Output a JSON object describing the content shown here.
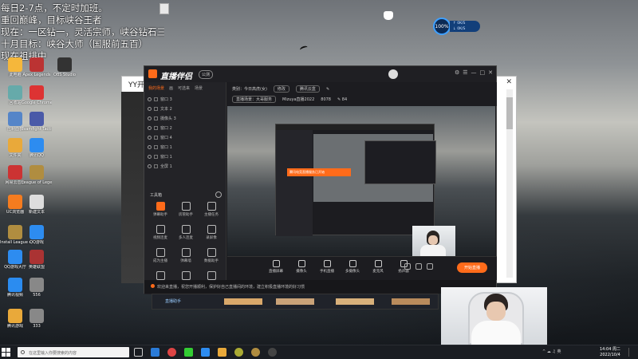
{
  "overlay": {
    "lines": [
      "每日2-7点，不定时加班。",
      "重回巅峰，目标峡谷王者",
      "现在：一区钻一，灵活宗师，峡谷钻石三",
      "十月目标：峡谷大师（国服前五百）",
      "现在祖排中"
    ]
  },
  "desktop_icons": [
    {
      "label": "此电脑",
      "color": "#f5b73b"
    },
    {
      "label": "Apex Legends",
      "color": "#b33"
    },
    {
      "label": "OBS Studio",
      "color": "#333"
    },
    {
      "label": "回收站",
      "color": "#6aa"
    },
    {
      "label": "Google Chrome",
      "color": "#d33"
    },
    {
      "label": "控制面板",
      "color": "#5585c8"
    },
    {
      "label": "Teamfight Tactics",
      "color": "#4a5aa8"
    },
    {
      "label": "文件夹",
      "color": "#e9a93a"
    },
    {
      "label": "腾讯QQ",
      "color": "#2d8cf0"
    },
    {
      "label": "网易云音乐",
      "color": "#c33"
    },
    {
      "label": "League of Legends",
      "color": "#b08d40"
    },
    {
      "label": "UC浏览器",
      "color": "#f57c1f"
    },
    {
      "label": "新建文本",
      "color": "#ddd"
    },
    {
      "label": "Install League of...",
      "color": "#b08d40"
    },
    {
      "label": "QQ游戏",
      "color": "#2d8cf0"
    },
    {
      "label": "QQ游戏大厅",
      "color": "#2d8cf0"
    },
    {
      "label": "英雄联盟",
      "color": "#a33"
    },
    {
      "label": "腾讯视频",
      "color": "#2b8cf0"
    },
    {
      "label": "556",
      "color": "#888"
    },
    {
      "label": "腾讯游戏",
      "color": "#e9a93a"
    },
    {
      "label": "333",
      "color": "#888"
    }
  ],
  "net_widget": {
    "percent": "100%",
    "up": "↑ 0K/S",
    "down": "↓ 0K/S"
  },
  "back_window": {
    "title": "YY开播",
    "close": "✕"
  },
  "app": {
    "name": "直播伴侣",
    "badge": "公测",
    "controls": [
      "⚙",
      "☰",
      "—",
      "□",
      "✕"
    ],
    "sidebar_tabs": [
      "我的场景",
      "画",
      "可选来",
      "场景"
    ],
    "scenes": [
      "窗口 3",
      "文本 2",
      "摄像头 3",
      "窗口 2",
      "窗口 4",
      "窗口 1",
      "窗口 1",
      "全屏 1"
    ],
    "tools_title": "工具箱",
    "tools": [
      "弹幕助手",
      "房管助手",
      "主播任务",
      "视频连麦",
      "多人连麦",
      "录屏像",
      "成为主播",
      "弹幕墙",
      "数据助手",
      "暂停直播",
      "弹幕姬",
      "更多"
    ],
    "info_row1": [
      "类别：今日高虎(女)",
      "修改",
      "腾讯云盒",
      "✎"
    ],
    "info_row2": [
      "直播场景：大哥服务",
      "Mizuya直播2022",
      "8078",
      "✎ 84"
    ],
    "toast": "腾讯电竞直播服务已开始",
    "toolbar": [
      "直播屏幕",
      "摄像头",
      "手机直播",
      "多摄像头",
      "麦克风",
      "扬声器"
    ],
    "start_live": "开始直播",
    "notice": "欢迎来直播，祝您开播顺利，保护好自己直播间的环境，建立积极直播环境的好习惯"
  },
  "lower_strip": {
    "label": "直播助手"
  },
  "taskbar": {
    "search_placeholder": "在这里输入你要搜索的内容",
    "tray": "^ ☁ ♫ 英",
    "time": "14:04 周二",
    "date": "2022/10/4"
  }
}
